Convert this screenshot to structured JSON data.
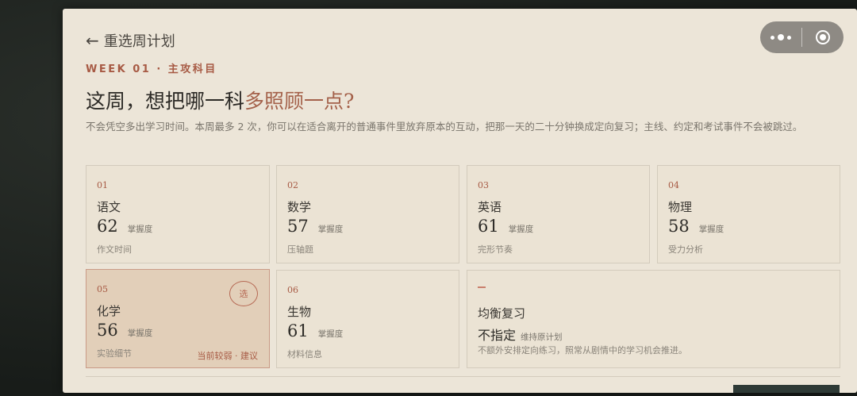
{
  "header": {
    "back_label": "重选周计划"
  },
  "capsule": {
    "more_icon": "more-dots-icon",
    "close_icon": "target-icon"
  },
  "kicker": "WEEK 01 · 主攻科目",
  "headline": {
    "prefix": "这周，想把哪一科",
    "accent": "多照顾一点?"
  },
  "description": "不会凭空多出学习时间。本周最多 2 次，你可以在适合离开的普通事件里放弃原本的互动，把那一天的二十分钟换成定向复习；主线、约定和考试事件不会被跳过。",
  "subjects": [
    {
      "num": "01",
      "name": "语文",
      "score": "62",
      "score_label": "掌握度",
      "note": "作文时间"
    },
    {
      "num": "02",
      "name": "数学",
      "score": "57",
      "score_label": "掌握度",
      "note": "压轴题"
    },
    {
      "num": "03",
      "name": "英语",
      "score": "61",
      "score_label": "掌握度",
      "note": "完形节奏"
    },
    {
      "num": "04",
      "name": "物理",
      "score": "58",
      "score_label": "掌握度",
      "note": "受力分析"
    },
    {
      "num": "05",
      "name": "化学",
      "score": "56",
      "score_label": "掌握度",
      "note": "实验细节",
      "badge": "选",
      "weak_tag": "当前较弱 · 建议"
    },
    {
      "num": "06",
      "name": "生物",
      "score": "61",
      "score_label": "掌握度",
      "note": "材料信息"
    }
  ],
  "balance": {
    "title": "均衡复习",
    "main": "不指定",
    "sub": "维持原计划",
    "note": "不额外安排定向练习，照常从剧情中的学习机会推进。"
  },
  "colors": {
    "accent": "#a75a44",
    "panel_bg": "#ece5d8",
    "selected_bg": "#e2cfb9"
  }
}
